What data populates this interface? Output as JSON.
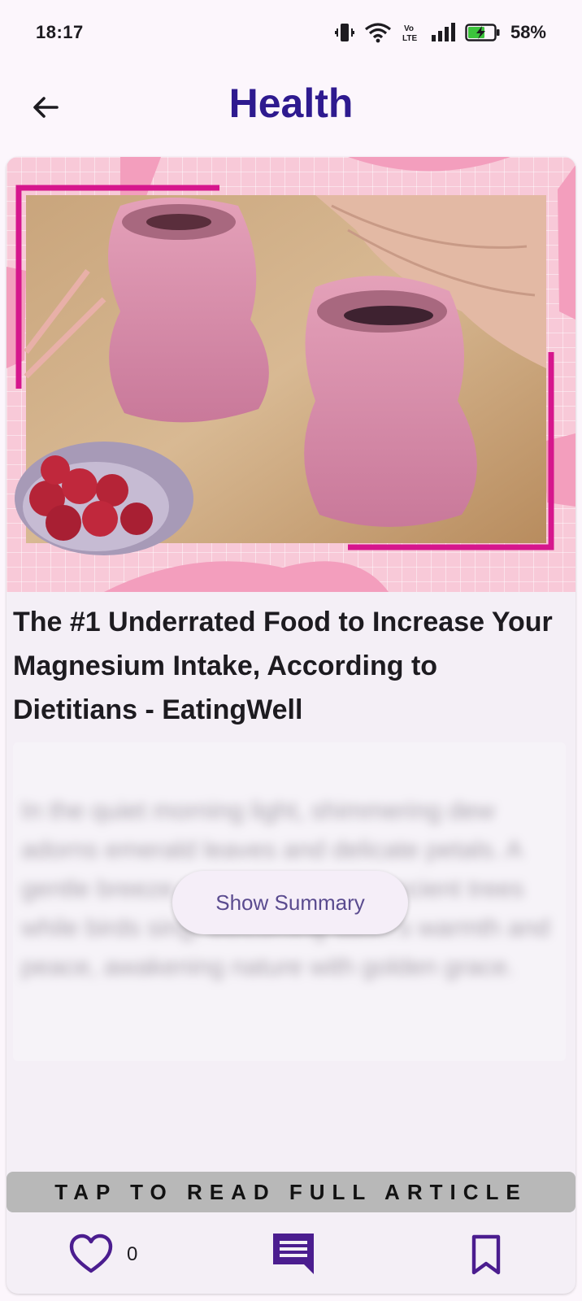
{
  "status_bar": {
    "time": "18:17",
    "battery_percent": "58%"
  },
  "app_bar": {
    "title": "Health"
  },
  "article": {
    "title": "The #1 Underrated Food to Increase Your Magnesium Intake, According to Dietitians - EatingWell",
    "summary_placeholder": "In the quiet morning light, shimmering dew adorns emerald leaves and delicate petals. A gentle breeze whispers through ancient trees while birds sing, welcoming dawn's warmth and peace, awakening nature with golden grace.",
    "show_summary_label": "Show Summary",
    "read_full_label": "TAP TO READ FULL ARTICLE",
    "like_count": "0"
  },
  "colors": {
    "title": "#2e1a8f",
    "icon_accent": "#4b1d8f",
    "hero_pink": "#f8c9d8"
  }
}
